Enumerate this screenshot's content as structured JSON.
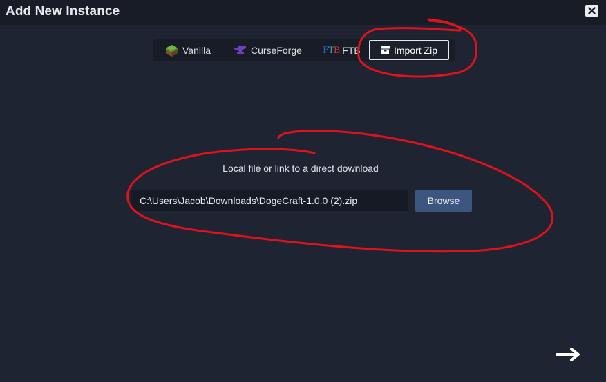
{
  "window": {
    "title": "Add New Instance",
    "close_icon": "close-x-icon"
  },
  "tabs": [
    {
      "label": "Vanilla",
      "icon": "grass-block-icon"
    },
    {
      "label": "CurseForge",
      "icon": "anvil-icon"
    },
    {
      "label": "FTB",
      "icon": "ftb-logo-icon"
    },
    {
      "label": "Import Zip",
      "icon": "archive-box-icon",
      "selected": true
    }
  ],
  "import": {
    "label": "Local file or link to a direct download",
    "path_value": "C:\\Users\\Jacob\\Downloads\\DogeCraft-1.0.0 (2).zip",
    "browse_label": "Browse"
  },
  "footer": {
    "next_icon": "arrow-right-icon"
  },
  "colors": {
    "background": "#1e2432",
    "titlebar": "#171c27",
    "browse_button": "#3c5680",
    "annotation_ink": "#e0121b"
  }
}
